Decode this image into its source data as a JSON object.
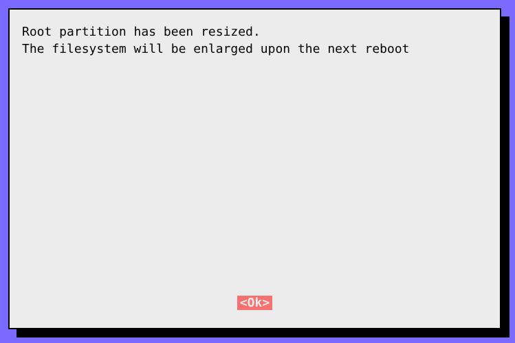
{
  "dialog": {
    "message_line1": "Root partition has been resized.",
    "message_line2": "The filesystem will be enlarged upon the next reboot",
    "ok_label": "<Ok>"
  },
  "colors": {
    "background": "#7a6aff",
    "panel": "#ececec",
    "button_bg": "#f87171",
    "button_fg": "#ececec",
    "text": "#000000",
    "shadow": "#000000"
  }
}
